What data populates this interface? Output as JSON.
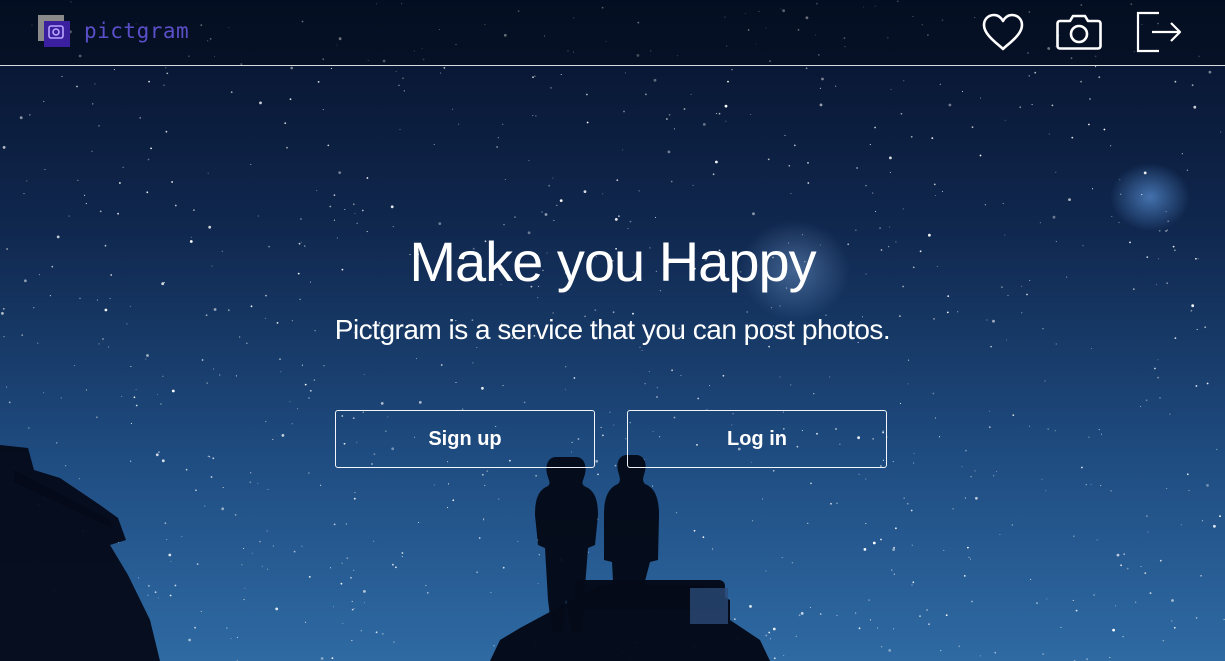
{
  "header": {
    "logo_text": "pictgram",
    "icons": [
      "heart-icon",
      "camera-icon",
      "logout-icon"
    ]
  },
  "hero": {
    "title": "Make you Happy",
    "subtitle": "Pictgram is a service that you can post photos.",
    "signup_label": "Sign up",
    "login_label": "Log in"
  },
  "colors": {
    "logo_text": "#5b4fc9",
    "logo_mark": "#3a1f9e",
    "sky_top": "#07122a",
    "sky_bottom": "#2f6aa3",
    "text": "#ffffff"
  }
}
